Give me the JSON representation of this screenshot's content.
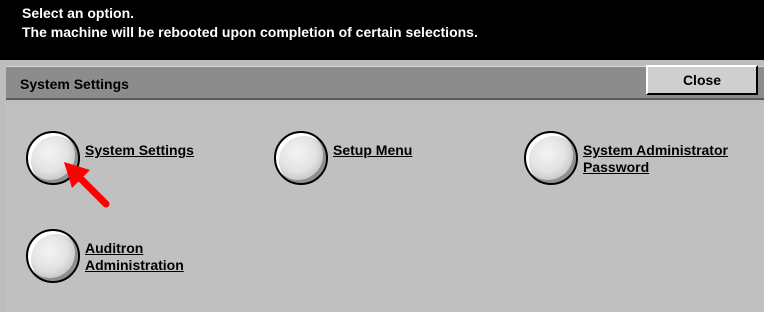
{
  "message": {
    "line1": "Select an option.",
    "line2": "The machine will be rebooted upon completion of certain selections."
  },
  "header": {
    "title": "System Settings",
    "close_label": "Close"
  },
  "options": [
    {
      "line1": "System Settings",
      "line2": ""
    },
    {
      "line1": "Setup Menu",
      "line2": ""
    },
    {
      "line1": "System Administrator",
      "line2": "Password"
    },
    {
      "line1": "Auditron",
      "line2": "Administration"
    }
  ],
  "colors": {
    "message_bg": "#000000",
    "title_bar_bg": "#8c8c8c",
    "panel_bg": "#c0c0c0",
    "pointer_arrow": "#ff0000"
  },
  "icons": {
    "pointer": "red-arrow-icon"
  }
}
